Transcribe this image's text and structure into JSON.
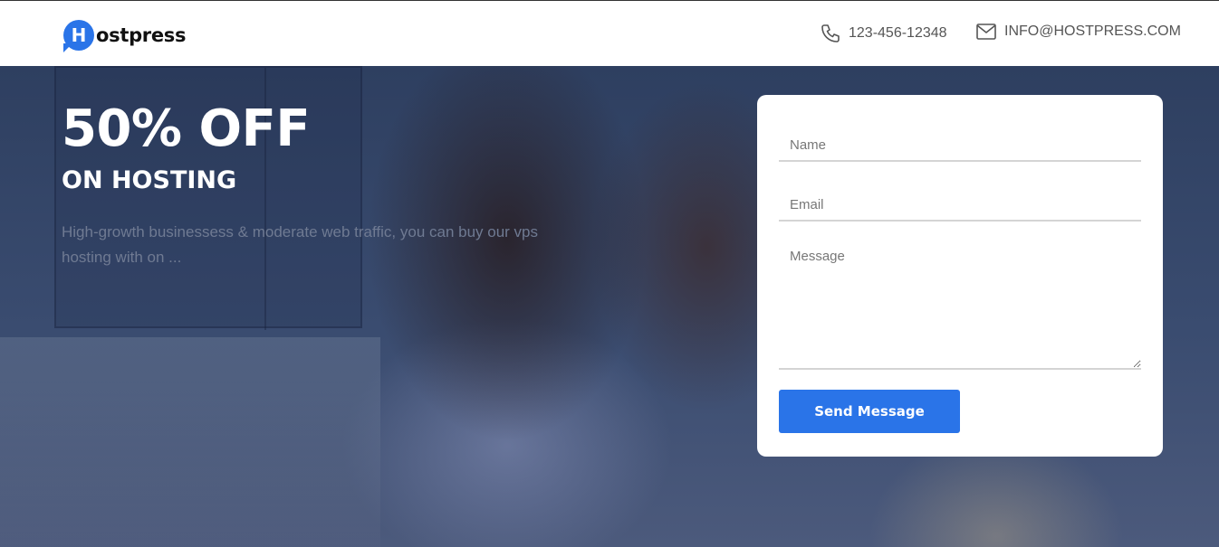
{
  "header": {
    "logo_badge": "H",
    "logo_text": "ostpress",
    "phone": "123-456-12348",
    "email": "INFO@HOSTPRESS.COM",
    "icons": {
      "phone": "phone-icon",
      "email": "mail-icon"
    }
  },
  "hero": {
    "title": "50% OFF",
    "subtitle": "ON HOSTING",
    "description": "High-growth businessess & moderate web traffic, you can buy our vps hosting with on ..."
  },
  "form": {
    "name_placeholder": "Name",
    "email_placeholder": "Email",
    "message_placeholder": "Message",
    "submit_label": "Send Message"
  },
  "colors": {
    "accent": "#2a74e8",
    "hero_overlay": "#2e3f60",
    "text_dark": "#111111",
    "text_muted": "#555555"
  }
}
